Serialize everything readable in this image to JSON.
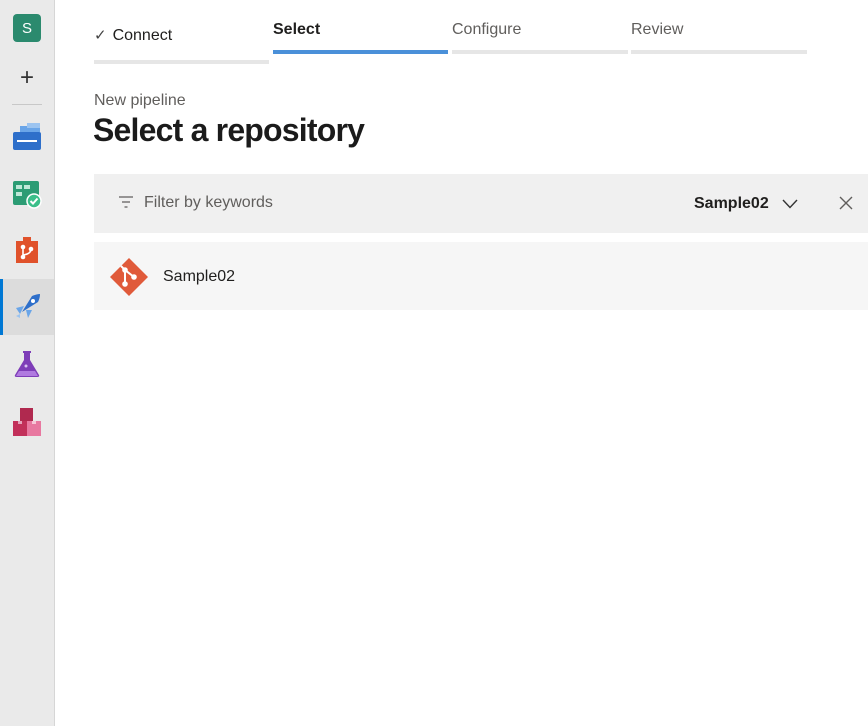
{
  "nav": {
    "avatar_letter": "S",
    "items": [
      {
        "name": "overview-icon"
      },
      {
        "name": "boards-icon"
      },
      {
        "name": "repos-icon"
      },
      {
        "name": "pipelines-icon"
      },
      {
        "name": "test-plans-icon"
      },
      {
        "name": "artifacts-icon"
      }
    ],
    "active_item": "pipelines-icon",
    "add_label": "+"
  },
  "stepper": {
    "steps": [
      {
        "label": "Connect",
        "state": "done"
      },
      {
        "label": "Select",
        "state": "current"
      },
      {
        "label": "Configure",
        "state": "upcoming"
      },
      {
        "label": "Review",
        "state": "upcoming"
      }
    ]
  },
  "page": {
    "subtitle": "New pipeline",
    "title": "Select a repository"
  },
  "filter": {
    "placeholder": "Filter by keywords",
    "selected_scope": "Sample02"
  },
  "repositories": [
    {
      "name": "Sample02",
      "icon": "git-icon"
    }
  ],
  "colors": {
    "accent": "#0078d4",
    "step_active": "#4a90d9",
    "git": "#e05a3a"
  }
}
